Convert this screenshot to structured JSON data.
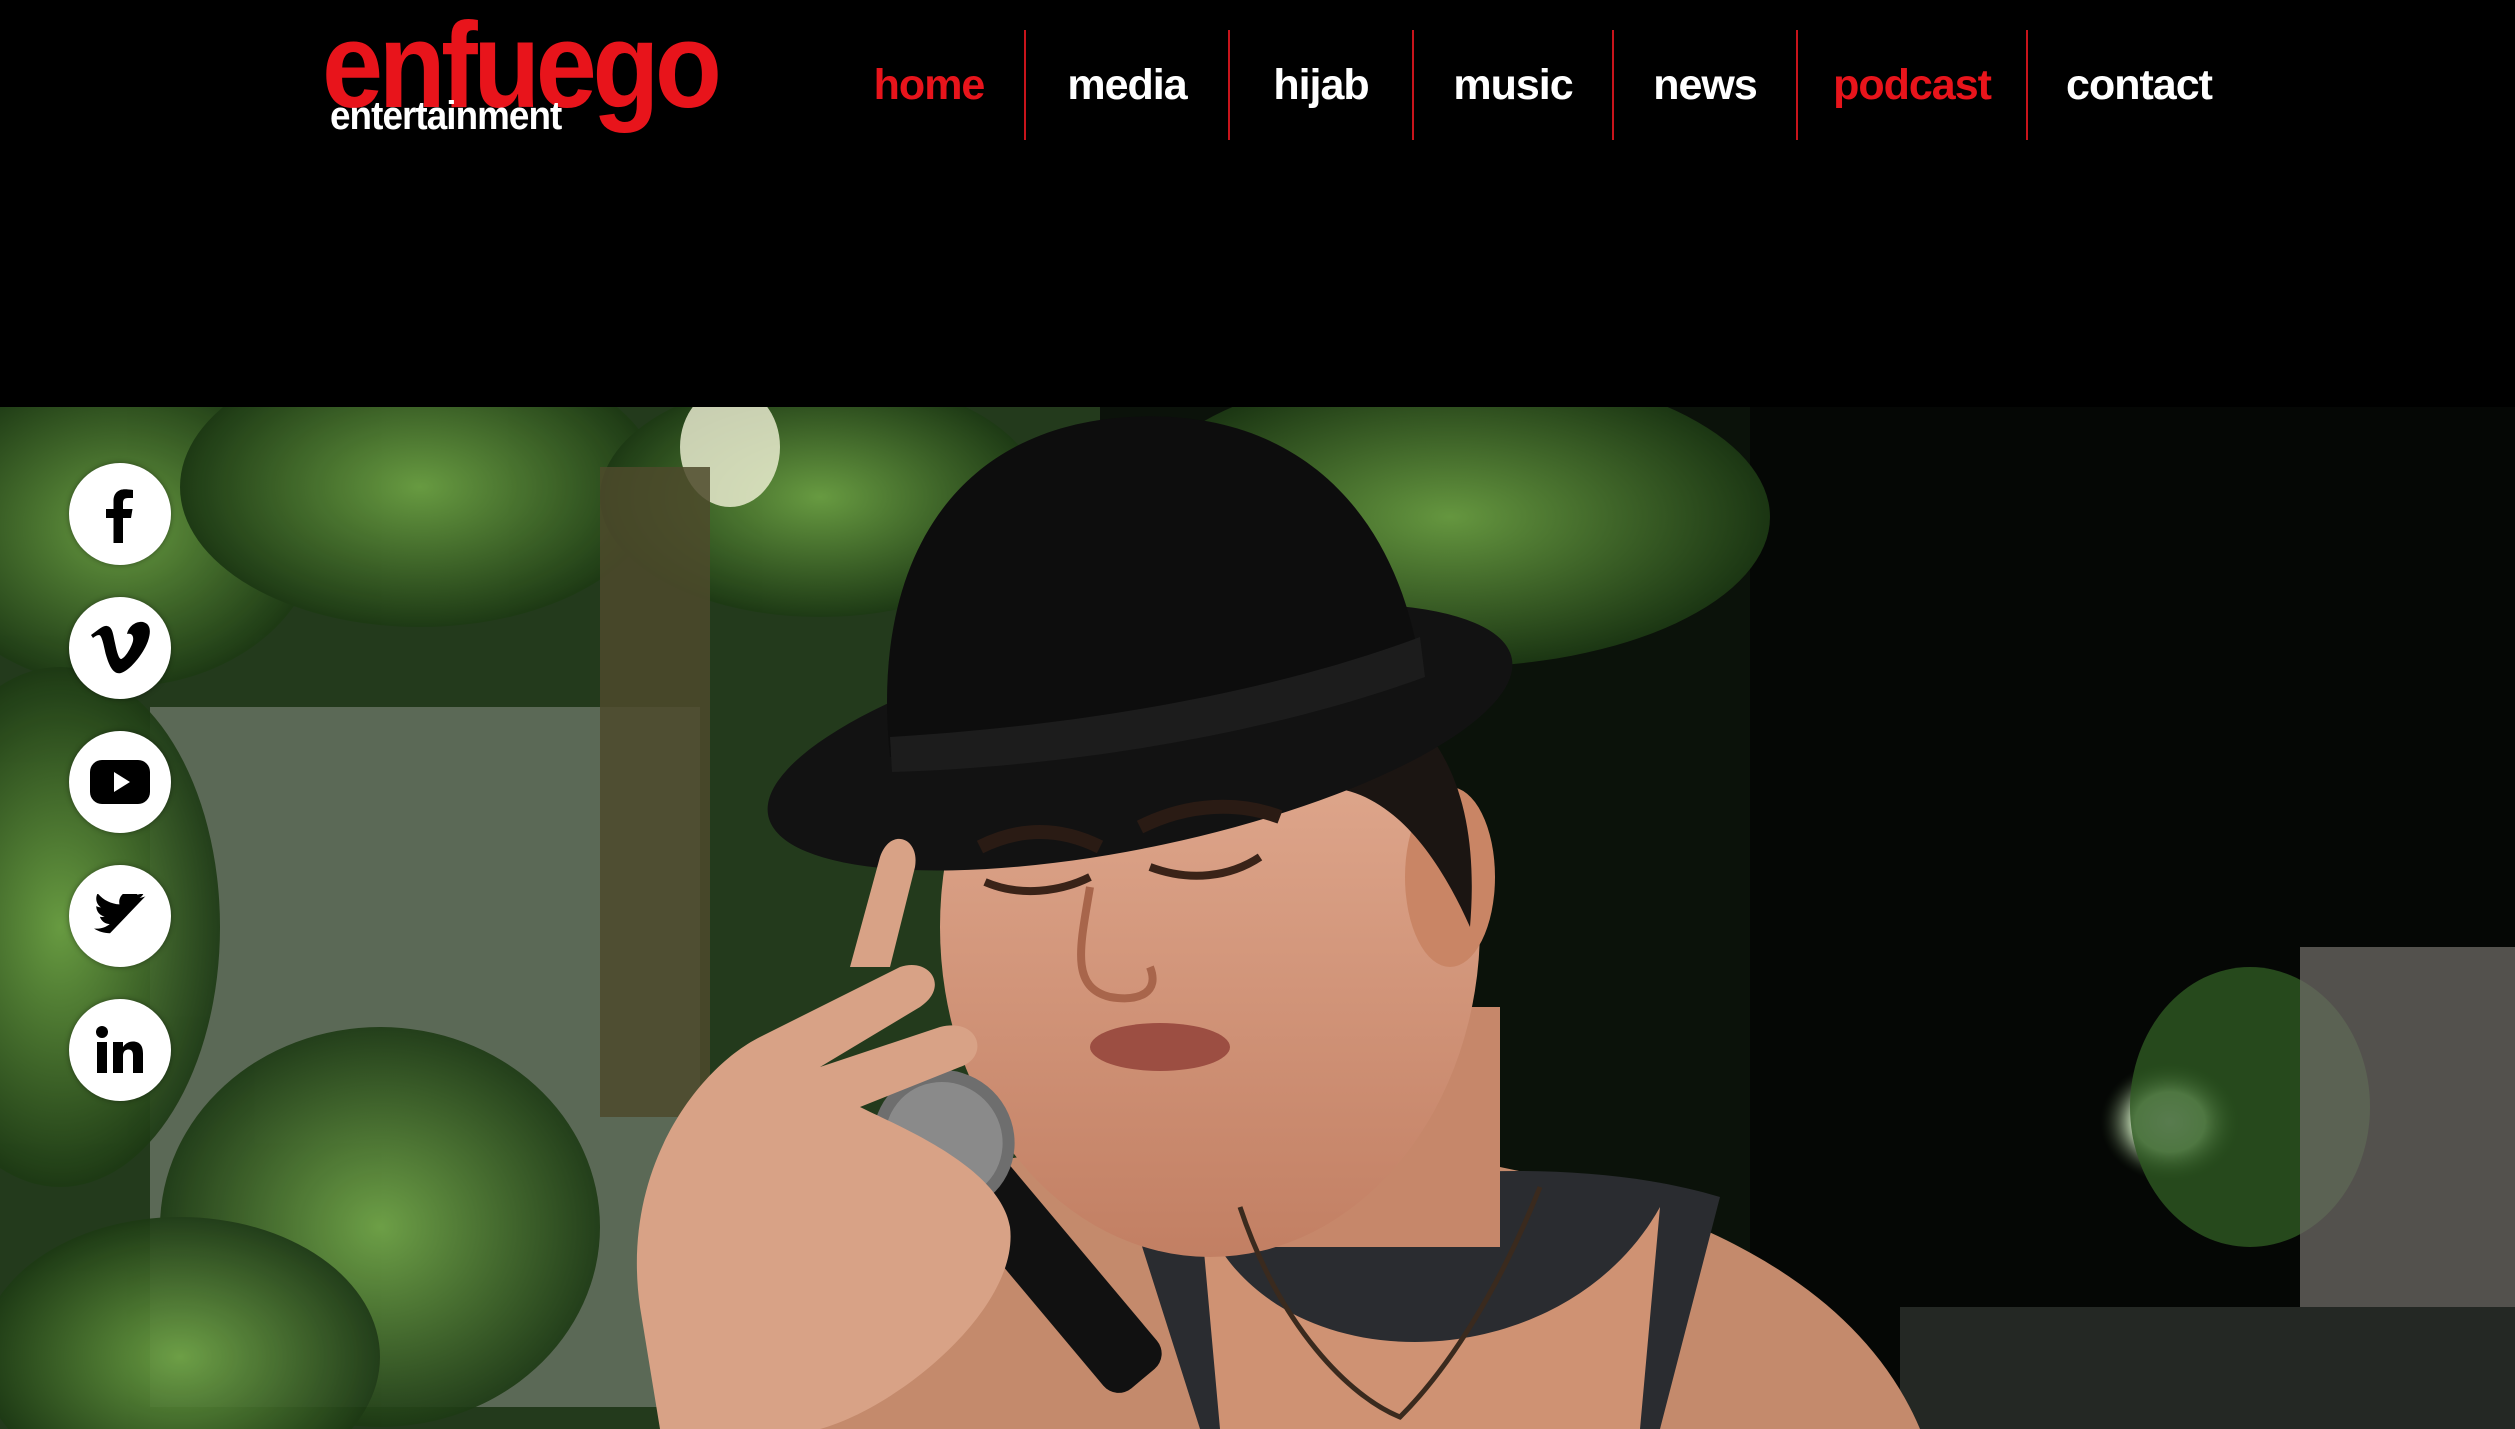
{
  "brand": {
    "logo_main": "enfuego",
    "logo_sub": "entertainment",
    "accent_color": "#e8141b"
  },
  "nav": {
    "items": [
      {
        "label": "home",
        "active": true
      },
      {
        "label": "media",
        "active": false
      },
      {
        "label": "hijab",
        "active": false
      },
      {
        "label": "music",
        "active": false
      },
      {
        "label": "news",
        "active": false
      },
      {
        "label": "podcast",
        "active": true
      },
      {
        "label": "contact",
        "active": false
      }
    ]
  },
  "social": [
    {
      "icon": "facebook-icon"
    },
    {
      "icon": "vimeo-icon"
    },
    {
      "icon": "youtube-icon"
    },
    {
      "icon": "twitter-icon"
    },
    {
      "icon": "linkedin-icon"
    }
  ],
  "hero": {
    "image": "singer-performing-icon"
  }
}
